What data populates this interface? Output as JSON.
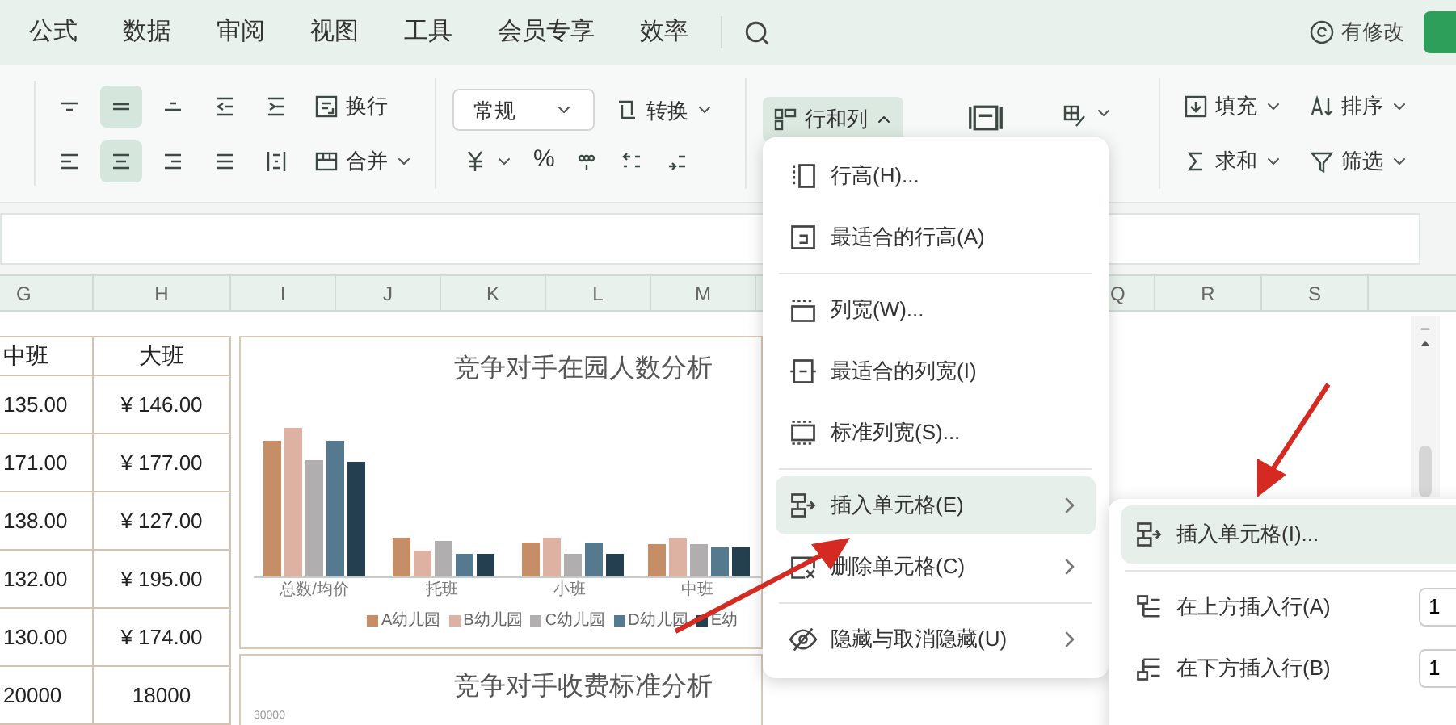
{
  "menu_tabs": [
    "公式",
    "数据",
    "审阅",
    "视图",
    "工具",
    "会员专享",
    "效率"
  ],
  "save_status": "有修改",
  "ribbon": {
    "align_row_1": [
      {
        "kind": "align-top",
        "selected": false
      },
      {
        "kind": "align-middle",
        "selected": true
      },
      {
        "kind": "align-bottom",
        "selected": false
      },
      {
        "kind": "indent-decrease",
        "selected": false
      },
      {
        "kind": "indent-increase",
        "selected": false
      }
    ],
    "align_row_2": [
      {
        "kind": "align-left",
        "selected": false
      },
      {
        "kind": "align-center",
        "selected": true
      },
      {
        "kind": "align-right",
        "selected": false
      },
      {
        "kind": "justify",
        "selected": false
      },
      {
        "kind": "distribute",
        "selected": false
      }
    ],
    "wrap_button": "换行",
    "merge_button": "合并",
    "number_format": "常规",
    "convert_button": "转换",
    "percent_button": "%",
    "rows_columns_button": {
      "label": "行和列",
      "expanded": true
    },
    "fill_button": "填充",
    "sort_button": "排序",
    "sum_button": "求和",
    "filter_button": "筛选"
  },
  "columns_left": [
    "G",
    "H",
    "I",
    "J",
    "K",
    "L",
    "M"
  ],
  "columns_right": [
    "Q",
    "R",
    "S"
  ],
  "table": {
    "header": [
      "中班",
      "大班"
    ],
    "rows": [
      [
        "135.00",
        "¥ 146.00"
      ],
      [
        "171.00",
        "¥ 177.00"
      ],
      [
        "138.00",
        "¥ 127.00"
      ],
      [
        "132.00",
        "¥ 195.00"
      ],
      [
        "130.00",
        "¥ 174.00"
      ],
      [
        "20000",
        "18000"
      ]
    ]
  },
  "charts": [
    {
      "title": "竞争对手在园人数分析",
      "categories": [
        "总数/均价",
        "托班",
        "小班",
        "中班"
      ],
      "legend": [
        {
          "label": "A幼儿园",
          "color": "#c68e66"
        },
        {
          "label": "B幼儿园",
          "color": "#ddb2a2"
        },
        {
          "label": "C幼儿园",
          "color": "#b0aeae"
        },
        {
          "label": "D幼儿园",
          "color": "#557a8f"
        },
        {
          "label": "E幼",
          "color": "#243f4f"
        }
      ]
    },
    {
      "title": "竞争对手收费标准分析",
      "axis_label": "30000"
    }
  ],
  "context_menu": [
    {
      "kind": "item",
      "label": "行高(H)...",
      "selected": false,
      "submenu": false
    },
    {
      "kind": "item",
      "label": "最适合的行高(A)",
      "selected": false,
      "submenu": false
    },
    {
      "kind": "separator"
    },
    {
      "kind": "item",
      "label": "列宽(W)...",
      "selected": false,
      "submenu": false
    },
    {
      "kind": "item",
      "label": "最适合的列宽(I)",
      "selected": false,
      "submenu": false
    },
    {
      "kind": "item",
      "label": "标准列宽(S)...",
      "selected": false,
      "submenu": false
    },
    {
      "kind": "separator"
    },
    {
      "kind": "item",
      "label": "插入单元格(E)",
      "selected": true,
      "submenu": true
    },
    {
      "kind": "item",
      "label": "删除单元格(C)",
      "selected": false,
      "submenu": true
    },
    {
      "kind": "separator"
    },
    {
      "kind": "item",
      "label": "隐藏与取消隐藏(U)",
      "selected": false,
      "submenu": true
    }
  ],
  "submenu": [
    {
      "kind": "item",
      "label": "插入单元格(I)...",
      "selected": true
    },
    {
      "kind": "separator"
    },
    {
      "kind": "count",
      "label": "在上方插入行(A)",
      "selected": false,
      "count": "1"
    },
    {
      "kind": "count",
      "label": "在下方插入行(B)",
      "selected": false,
      "count": "1"
    }
  ]
}
